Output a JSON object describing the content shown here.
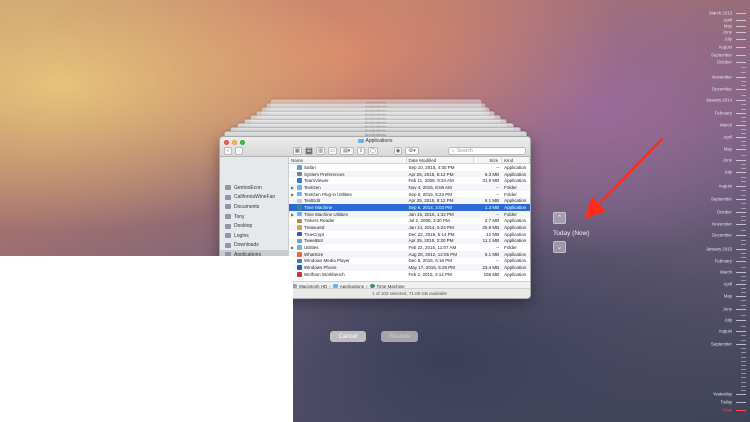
{
  "window": {
    "title": "Applications",
    "stack_title": "Applications",
    "search_placeholder": "Search"
  },
  "sidebar": {
    "items": [
      {
        "label": "GentooEcon",
        "icon": "folder-icon"
      },
      {
        "label": "CaliforniaWineFan",
        "icon": "folder-icon"
      },
      {
        "label": "Documents",
        "icon": "documents-icon"
      },
      {
        "label": "Tony",
        "icon": "home-icon"
      },
      {
        "label": "Desktop",
        "icon": "desktop-icon"
      },
      {
        "label": "Logins",
        "icon": "folder-icon"
      },
      {
        "label": "Downloads",
        "icon": "downloads-icon"
      },
      {
        "label": "Applications",
        "icon": "applications-icon"
      }
    ]
  },
  "columns": {
    "name": "Name",
    "date": "Date Modified",
    "size": "Size",
    "kind": "Kind"
  },
  "rows": [
    {
      "name": "Safari",
      "date": "Sep 10, 2015, 4:30 PM",
      "size": "--",
      "kind": "Application",
      "color": "#5aa0e0",
      "disclose": ""
    },
    {
      "name": "System Preferences",
      "date": "Apr 25, 2015, 8:12 PM",
      "size": "6.3 MB",
      "kind": "Application",
      "color": "#7b7f86",
      "disclose": ""
    },
    {
      "name": "TeamViewer",
      "date": "Feb 11, 2008, 9:34 AM",
      "size": "31.9 MB",
      "kind": "Application",
      "color": "#2e7ad1",
      "disclose": ""
    },
    {
      "name": "TextGen",
      "date": "Nov 4, 2015, 8:08 AM",
      "size": "--",
      "kind": "Folder",
      "color": "#6cb2ea",
      "disclose": "▶"
    },
    {
      "name": "TextGen Plug-in Utilities",
      "date": "Sep 6, 2015, 5:23 PM",
      "size": "--",
      "kind": "Folder",
      "color": "#6cb2ea",
      "disclose": "▶"
    },
    {
      "name": "TextEdit",
      "date": "Apr 25, 2015, 8:12 PM",
      "size": "6.1 MB",
      "kind": "Application",
      "color": "#c9c9c9",
      "disclose": ""
    },
    {
      "name": "Time Machine",
      "date": "Sep 8, 2014, 3:03 PM",
      "size": "1.3 MB",
      "kind": "Application",
      "color": "#3a8f6b",
      "disclose": "",
      "selected": true
    },
    {
      "name": "Time Machine Utilities",
      "date": "Jan 15, 2015, 1:32 PM",
      "size": "--",
      "kind": "Folder",
      "color": "#6cb2ea",
      "disclose": "▶"
    },
    {
      "name": "Tinkers Reader",
      "date": "Jul 2, 2008, 3:30 PM",
      "size": "2.7 MB",
      "kind": "Application",
      "color": "#b0884f",
      "disclose": ""
    },
    {
      "name": "Treasured",
      "date": "Jan 14, 2014, 5:24 PM",
      "size": "25.8 MB",
      "kind": "Application",
      "color": "#d4a33a",
      "disclose": ""
    },
    {
      "name": "TrueCrypt",
      "date": "Dec 22, 2015, 5:14 PM",
      "size": "12 MB",
      "kind": "Application",
      "color": "#3b5d9a",
      "disclose": ""
    },
    {
      "name": "TweetBot",
      "date": "Apr 25, 2015, 2:20 PM",
      "size": "11.1 MB",
      "kind": "Application",
      "color": "#5fa2d8",
      "disclose": ""
    },
    {
      "name": "Utilities",
      "date": "Feb 22, 2015, 11:07 AM",
      "size": "--",
      "kind": "Folder",
      "color": "#6cb2ea",
      "disclose": "▶"
    },
    {
      "name": "WhatSize",
      "date": "Aug 28, 2012, 12:05 PM",
      "size": "8.1 MB",
      "kind": "Application",
      "color": "#e06b3a",
      "disclose": ""
    },
    {
      "name": "Windows Media Player",
      "date": "Dec 8, 2015, 6:16 PM",
      "size": "--",
      "kind": "Application",
      "color": "#3a78c7",
      "disclose": ""
    },
    {
      "name": "Windows Phone",
      "date": "May 17, 2015, 5:25 PM",
      "size": "23.4 MB",
      "kind": "Application",
      "color": "#2a62b3",
      "disclose": ""
    },
    {
      "name": "Wolfram Workbench",
      "date": "Feb 2, 2015, 3:14 PM",
      "size": "158 MB",
      "kind": "Application",
      "color": "#c0392b",
      "disclose": ""
    }
  ],
  "pathbar": {
    "disk": "Macintosh HD",
    "folder": "Applications",
    "item": "Time Machine"
  },
  "status": "1 of 103 selected, 71.09 GB available",
  "buttons": {
    "cancel": "Cancel",
    "restore": "Restore"
  },
  "navigator": {
    "today_label": "Today (Now)"
  },
  "timeline": [
    {
      "label": "March 2013",
      "major": true
    },
    {
      "label": "April",
      "major": true
    },
    {
      "label": "May",
      "major": true
    },
    {
      "label": "June",
      "major": true
    },
    {
      "label": "July",
      "major": true
    },
    {
      "label": "August",
      "major": true
    },
    {
      "label": "September",
      "major": true
    },
    {
      "label": "October",
      "major": true
    },
    {
      "label": "November",
      "major": true
    },
    {
      "label": "December",
      "major": true
    },
    {
      "label": "January 2014",
      "major": true
    },
    {
      "label": "February",
      "major": true
    },
    {
      "label": "March",
      "major": true
    },
    {
      "label": "April",
      "major": true
    },
    {
      "label": "May",
      "major": true
    },
    {
      "label": "June",
      "major": true
    },
    {
      "label": "July",
      "major": true
    },
    {
      "label": "August",
      "major": true
    },
    {
      "label": "September",
      "major": true
    },
    {
      "label": "October",
      "major": true
    },
    {
      "label": "November",
      "major": true
    },
    {
      "label": "December",
      "major": true
    },
    {
      "label": "January 2015",
      "major": true
    },
    {
      "label": "February",
      "major": true
    },
    {
      "label": "March",
      "major": true
    },
    {
      "label": "April",
      "major": true
    },
    {
      "label": "May",
      "major": true
    },
    {
      "label": "June",
      "major": true
    },
    {
      "label": "July",
      "major": true
    },
    {
      "label": "August",
      "major": true
    },
    {
      "label": "September",
      "major": true
    },
    {
      "label": "Yesterday",
      "major": true
    },
    {
      "label": "Today",
      "major": true
    }
  ],
  "timeline_now": "Now",
  "colors": {
    "selection": "#2b69d6",
    "arrow": "#ff2a1a",
    "now": "#ff4a3a"
  }
}
